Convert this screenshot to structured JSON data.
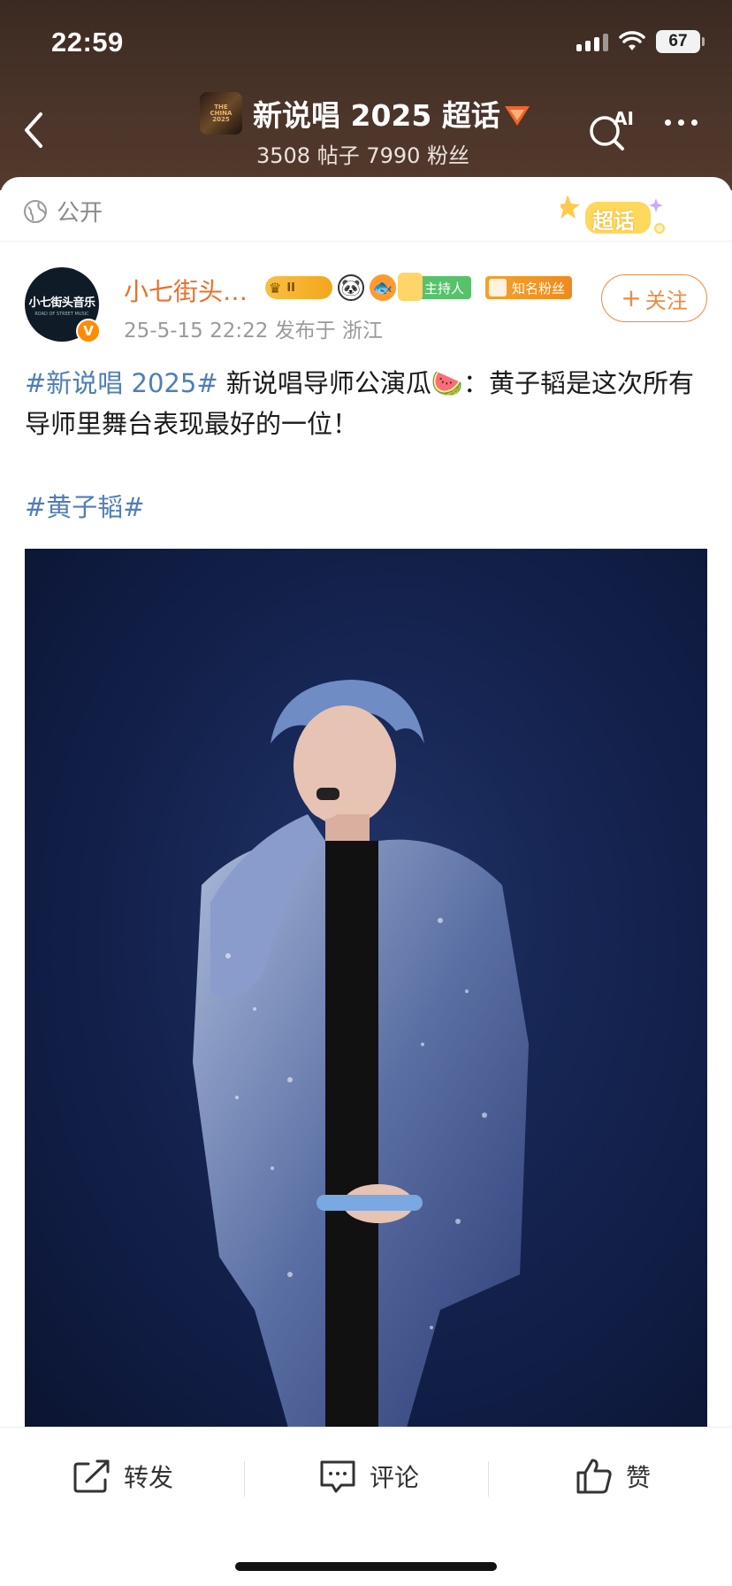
{
  "status_bar": {
    "time": "22:59",
    "battery": "67"
  },
  "header": {
    "back_icon": "chevron-left-icon",
    "topic_title": "新说唱 2025 超话",
    "topic_stats": "3508 帖子 7990 粉丝",
    "ai_label": "AI",
    "more_icon": "more-icon"
  },
  "card": {
    "privacy_label": "公开",
    "sticker_label": "超话"
  },
  "post": {
    "username": "小七街头…",
    "avatar_text": "小七街头音乐",
    "crown_badge": "II",
    "host_badge": "主持人",
    "fan_badge": "知名粉丝",
    "meta": "25-5-15 22:22  发布于 浙江",
    "follow_label": "关注",
    "text_hashtag": "#新说唱 2025#",
    "text_body": " 新说唱导师公演瓜🍉：黄子韬是这次所有导师里舞台表现最好的一位！",
    "tag": "#黄子韬#"
  },
  "actions": {
    "repost": "转发",
    "comment": "评论",
    "like": "赞"
  },
  "colors": {
    "accent_orange": "#f08a3e",
    "hashtag_blue": "#4f7eb7",
    "header_brown": "#4a3429"
  }
}
